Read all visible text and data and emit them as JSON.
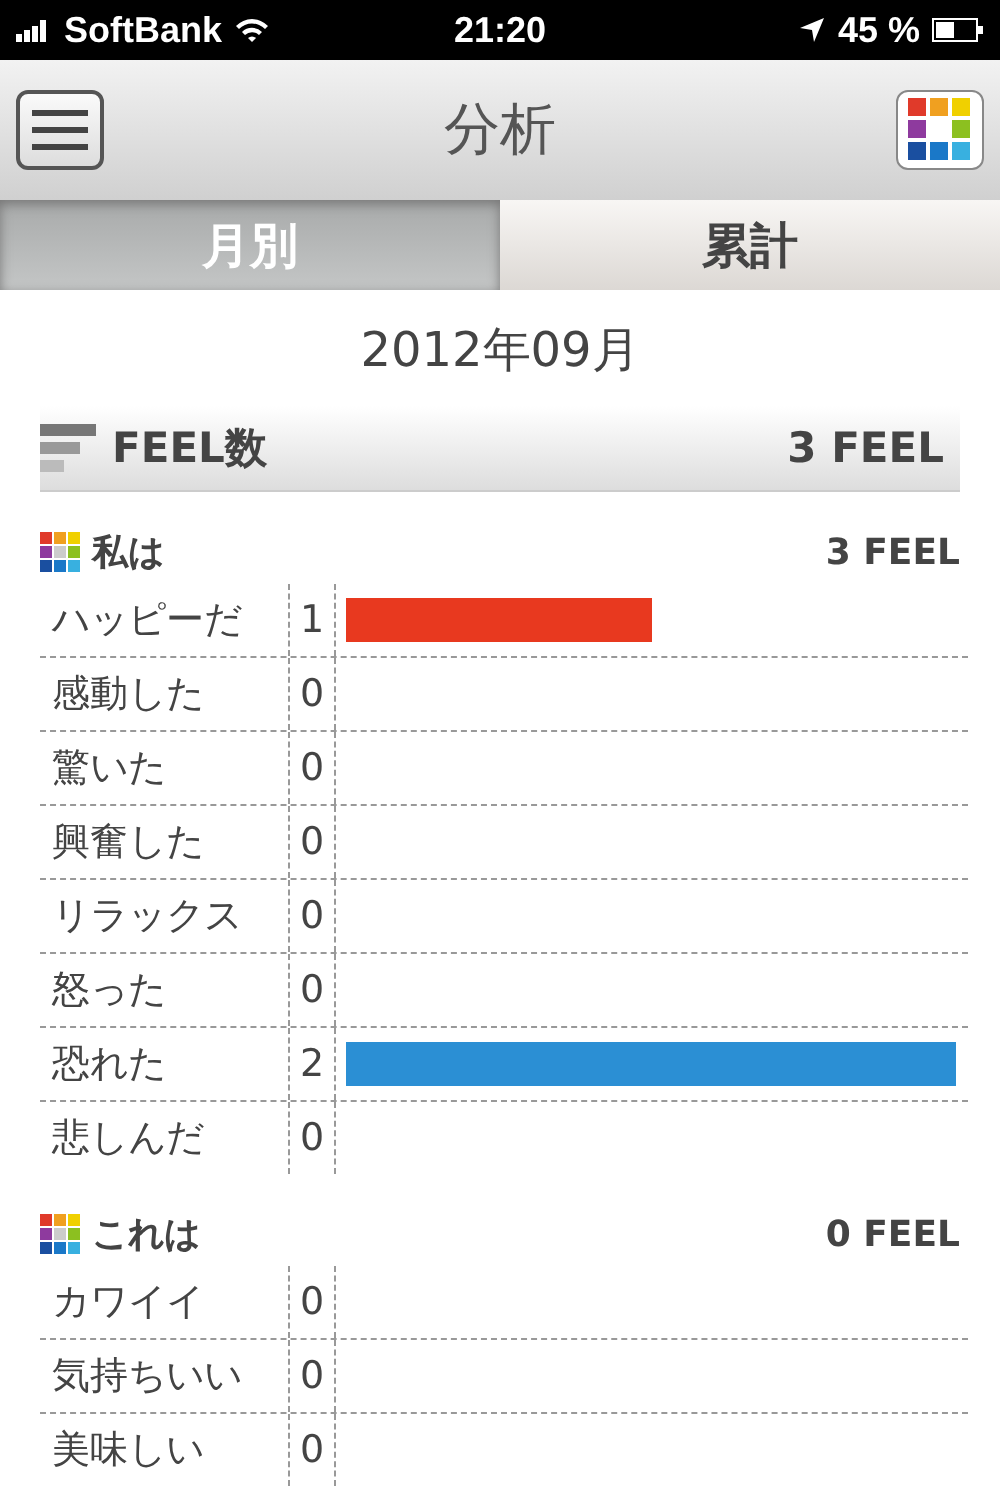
{
  "status_bar": {
    "carrier": "SoftBank",
    "time": "21:20",
    "battery": "45 %"
  },
  "nav": {
    "title": "分析"
  },
  "tabs": [
    {
      "label": "月別",
      "selected": true
    },
    {
      "label": "累計",
      "selected": false
    }
  ],
  "date": "2012年09月",
  "summary": {
    "title": "FEEL数",
    "total": "3 FEEL"
  },
  "sections": [
    {
      "title": "私は",
      "total": "3 FEEL",
      "rows": [
        {
          "label": "ハッピーだ",
          "count": "1",
          "color": "#e8391f"
        },
        {
          "label": "感動した",
          "count": "0"
        },
        {
          "label": "驚いた",
          "count": "0"
        },
        {
          "label": "興奮した",
          "count": "0"
        },
        {
          "label": "リラックス",
          "count": "0"
        },
        {
          "label": "怒った",
          "count": "0"
        },
        {
          "label": "恐れた",
          "count": "2",
          "color": "#2b8fd4"
        },
        {
          "label": "悲しんだ",
          "count": "0"
        }
      ]
    },
    {
      "title": "これは",
      "total": "0 FEEL",
      "rows": [
        {
          "label": "カワイイ",
          "count": "0"
        },
        {
          "label": "気持ちいい",
          "count": "0"
        },
        {
          "label": "美味しい",
          "count": "0"
        }
      ]
    }
  ]
}
